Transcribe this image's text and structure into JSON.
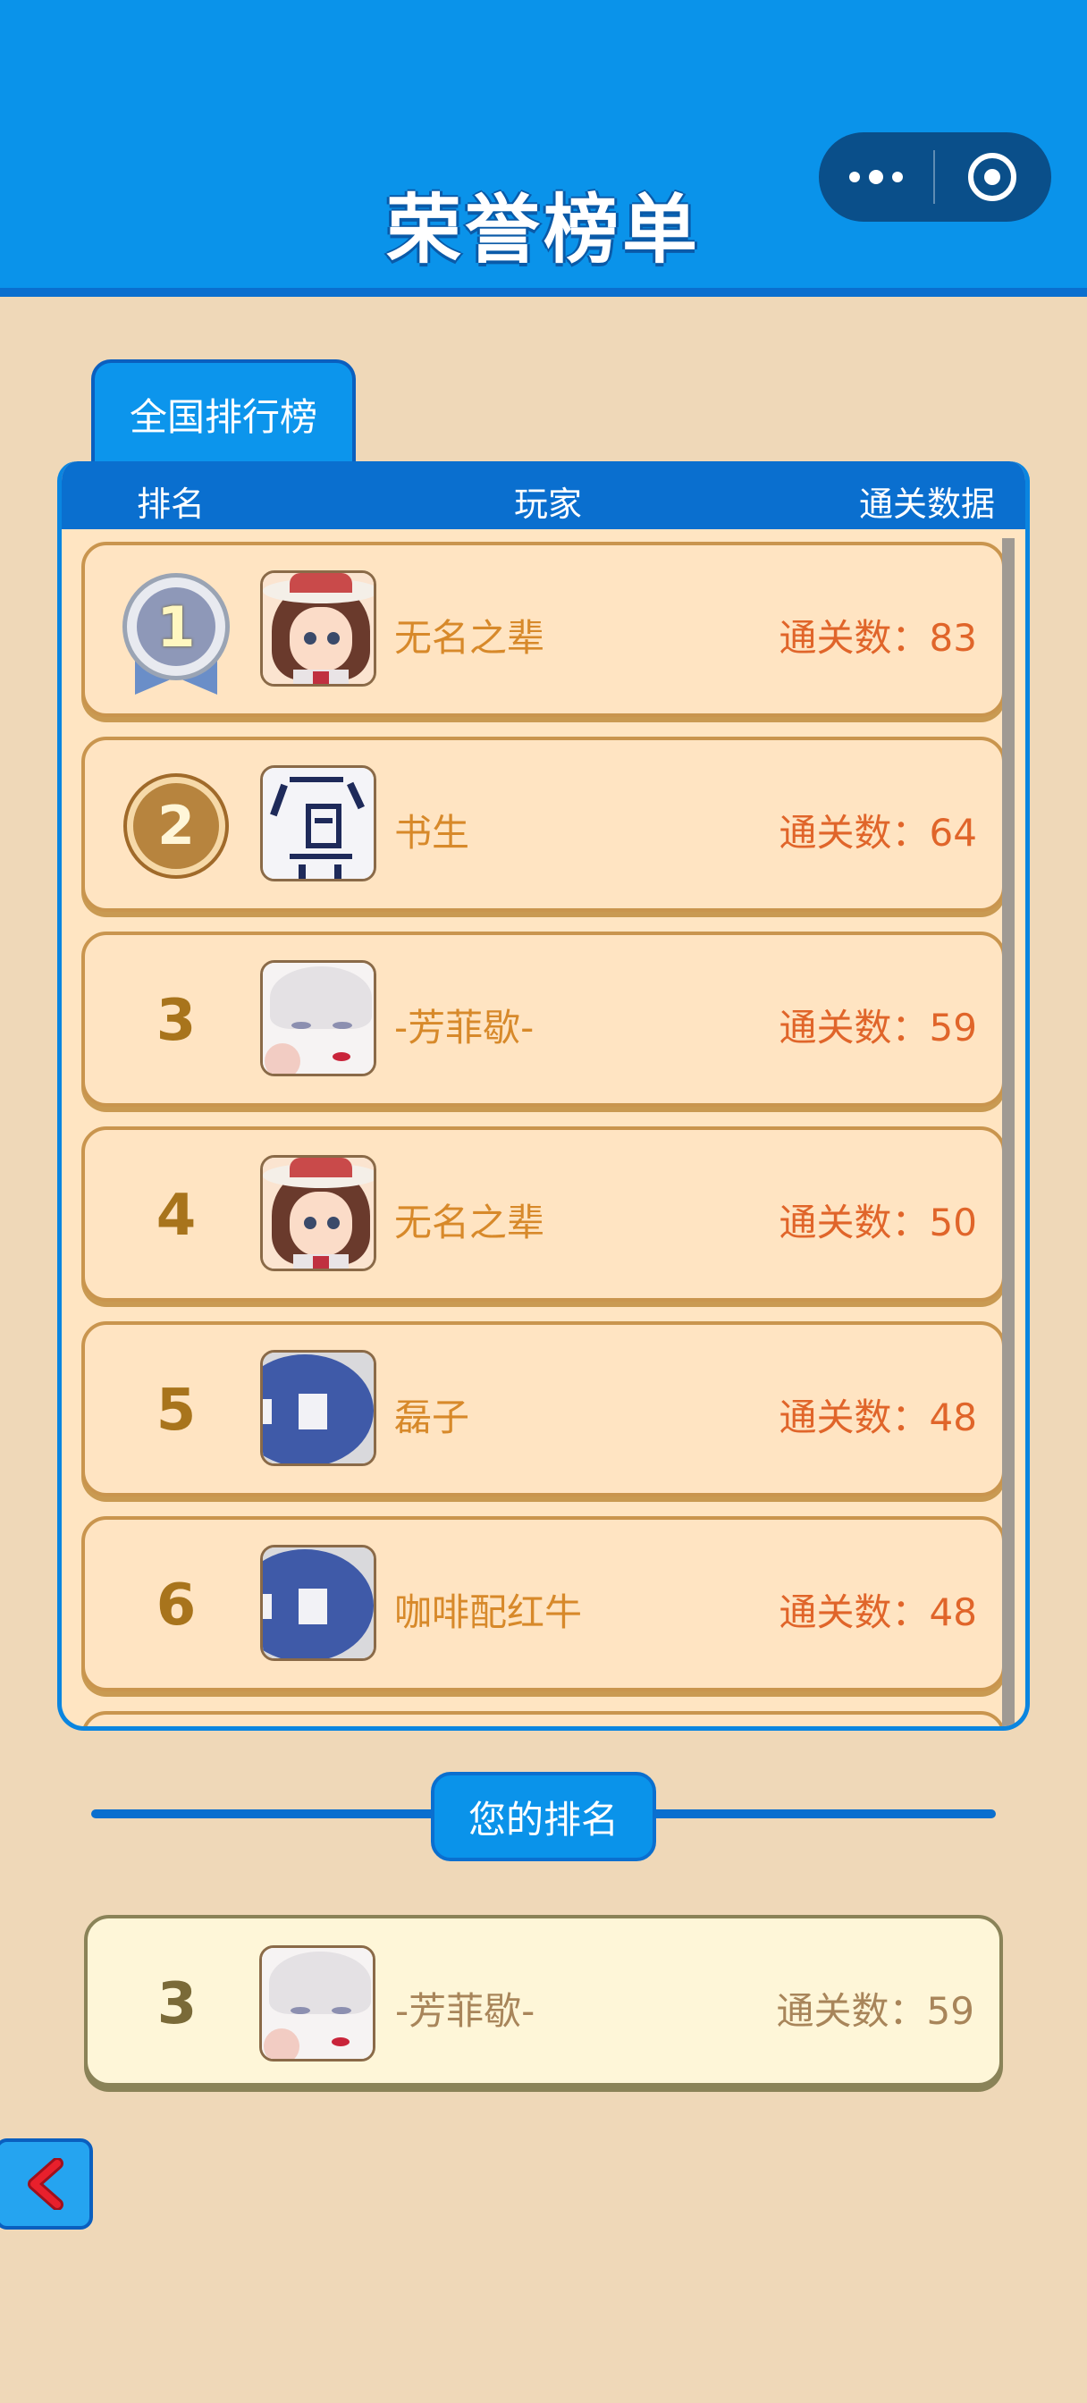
{
  "header": {
    "title": "荣誉榜单",
    "capsule": {
      "more_icon": "more-dots-icon",
      "close_icon": "target-circle-icon"
    },
    "color": "#0a93ea"
  },
  "tab": {
    "label": "全国排行榜"
  },
  "board": {
    "columns": {
      "rank": "排名",
      "player": "玩家",
      "data": "通关数据"
    },
    "rows": [
      {
        "rank": "1",
        "avatar": "anime-girl-avatar",
        "name": "无名之辈",
        "score": "通关数：83"
      },
      {
        "rank": "2",
        "avatar": "calligraphy-avatar",
        "name": "书生",
        "score": "通关数：64"
      },
      {
        "rank": "3",
        "avatar": "white-hair-avatar",
        "name": "-芳菲歇-",
        "score": "通关数：59"
      },
      {
        "rank": "4",
        "avatar": "anime-girl-avatar",
        "name": "无名之辈",
        "score": "通关数：50"
      },
      {
        "rank": "5",
        "avatar": "blue-coin-avatar",
        "name": "磊子",
        "score": "通关数：48"
      },
      {
        "rank": "6",
        "avatar": "blue-coin-avatar",
        "name": "咖啡配红牛",
        "score": "通关数：48"
      }
    ]
  },
  "your_rank": {
    "label": "您的排名",
    "rank": "3",
    "avatar": "white-hair-avatar",
    "name": "-芳菲歇-",
    "score": "通关数：59"
  },
  "back_button": {
    "icon": "chevron-left-icon"
  }
}
